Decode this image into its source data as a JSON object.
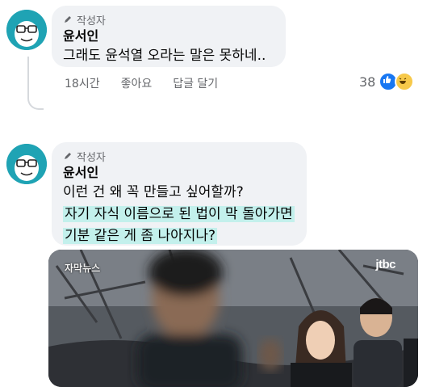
{
  "comments": [
    {
      "badge": "작성자",
      "author": "윤서인",
      "lines": [
        "그래도 윤석열 오라는 말은 못하네.."
      ],
      "time": "18시간",
      "like_label": "좋아요",
      "reply_label": "답글 달기",
      "reaction_count": "38",
      "reactions": [
        "like-icon",
        "haha-icon"
      ]
    },
    {
      "badge": "작성자",
      "author": "윤서인",
      "lines": [
        "이런 건 왜 꼭 만들고 싶어할까?",
        "자기 자식 이름으로 된 법이 막 돌아가면",
        "기분 같은 게 좀 나아지나?"
      ],
      "highlighted_lines": [
        1,
        2
      ]
    }
  ],
  "video": {
    "caption_label": "자막뉴스",
    "channel_logo": "jtbc"
  },
  "colors": {
    "bubble": "#f0f2f5",
    "highlight": "#c3f0ec",
    "avatar_bg": "#1fa3b4",
    "like_blue": "#1877f2"
  }
}
